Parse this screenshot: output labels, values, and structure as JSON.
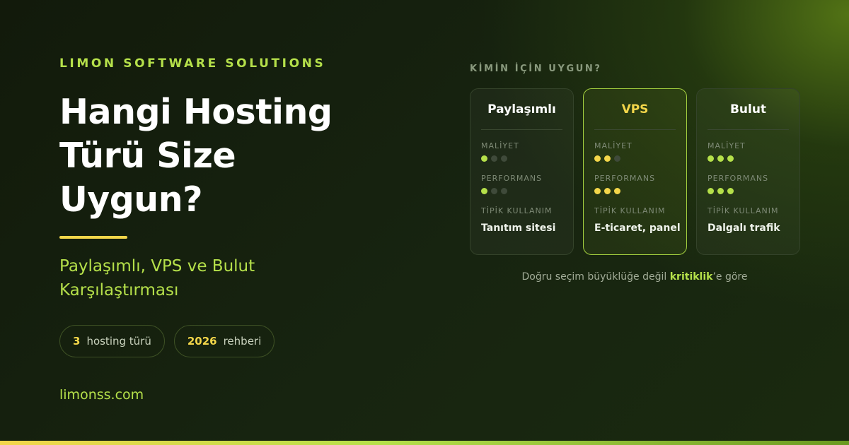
{
  "brand": "LIMON SOFTWARE SOLUTIONS",
  "headline": {
    "line1": "Hangi Hosting",
    "line2": "Türü Size",
    "line3": "Uygun?"
  },
  "subtitle": {
    "line1": "Paylaşımlı, VPS ve Bulut",
    "line2": "Karşılaştırması"
  },
  "pills": [
    {
      "number": "3",
      "text": "hosting türü"
    },
    {
      "number": "2026",
      "text": "rehberi"
    }
  ],
  "url": "limonss.com",
  "comparison": {
    "section_label": "KİMİN İÇİN UYGUN?",
    "metric_labels": {
      "cost": "MALİYET",
      "performance": "PERFORMANS",
      "usage": "TİPİK KULLANIM"
    },
    "dot_max": 3,
    "cards": [
      {
        "title": "Paylaşımlı",
        "cost_level": 1,
        "performance_level": 1,
        "usage": "Tanıtım sitesi",
        "featured": false
      },
      {
        "title": "VPS",
        "cost_level": 2,
        "performance_level": 3,
        "usage": "E-ticaret, panel",
        "featured": true
      },
      {
        "title": "Bulut",
        "cost_level": 3,
        "performance_level": 3,
        "usage": "Dalgalı trafik",
        "featured": false
      }
    ],
    "footnote": {
      "before": "Doğru seçim büyüklüğe değil ",
      "highlight": "kritiklik",
      "after": "’e göre"
    }
  },
  "colors": {
    "accent_green": "#b5e04a",
    "accent_yellow": "#f3d64a",
    "dot_off": "#3f4a3a"
  }
}
